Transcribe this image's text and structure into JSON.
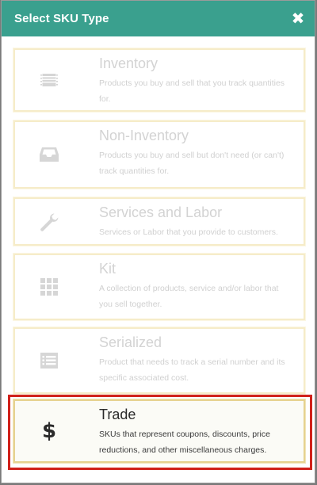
{
  "header": {
    "title": "Select SKU Type",
    "close_glyph": "✖"
  },
  "sku_types": [
    {
      "title": "Inventory",
      "description": "Products you buy and sell that you track quantities for.",
      "icon": "barcode-icon"
    },
    {
      "title": "Non-Inventory",
      "description": "Products you buy and sell but don't need (or can't) track quantities for.",
      "icon": "inbox-tray-icon"
    },
    {
      "title": "Services and Labor",
      "description": "Services or Labor that you provide to customers.",
      "icon": "wrench-icon"
    },
    {
      "title": "Kit",
      "description": "A collection of products, service and/or labor that you sell together.",
      "icon": "grid-icon"
    },
    {
      "title": "Serialized",
      "description": "Product that needs to track a serial number and its specific associated cost.",
      "icon": "list-icon"
    },
    {
      "title": "Trade",
      "description": "SKUs that represent coupons, discounts, price reductions, and other miscellaneous charges.",
      "icon": "dollar-icon",
      "icon_glyph": "$",
      "selected": true
    }
  ],
  "colors": {
    "header_bg": "#3aa08e",
    "highlight": "#d0211b",
    "card_border": "#f6ecc9"
  }
}
